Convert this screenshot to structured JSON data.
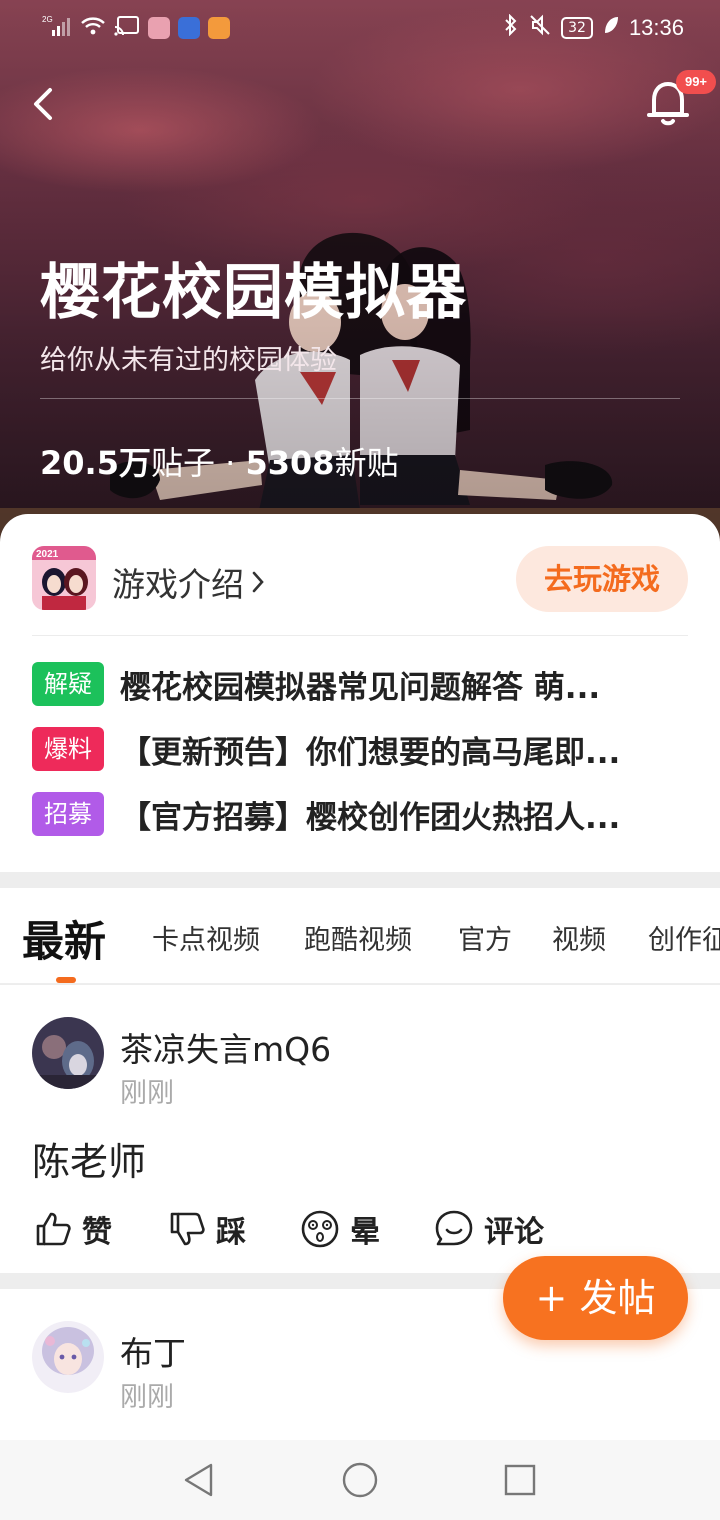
{
  "status_bar": {
    "network": "2G",
    "battery": "32",
    "time": "13:36"
  },
  "header": {
    "notification_badge": "99+"
  },
  "forum": {
    "title": "樱花校园模拟器",
    "subtitle": "给你从未有过的校园体验",
    "posts_count": "20.5万",
    "posts_label": "贴子",
    "separator": " · ",
    "new_count": "5308",
    "new_label": "新贴"
  },
  "game": {
    "intro_label": "游戏介绍",
    "play_button": "去玩游戏",
    "icon_year": "2021"
  },
  "notices": [
    {
      "tag": "解疑",
      "tag_color": "#1cc15b",
      "text": "樱花校园模拟器常见问题解答 萌..."
    },
    {
      "tag": "爆料",
      "tag_color": "#ee2a5a",
      "text": "【更新预告】你们想要的高马尾即..."
    },
    {
      "tag": "招募",
      "tag_color": "#b15be8",
      "text": "【官方招募】樱校创作团火热招人..."
    }
  ],
  "tabs": [
    "最新",
    "卡点视频",
    "跑酷视频",
    "官方",
    "视频",
    "创作征"
  ],
  "posts": [
    {
      "username": "茶凉失言mQ6",
      "time": "刚刚",
      "content": "陈老师",
      "actions": {
        "like": "赞",
        "dislike": "踩",
        "dizzy": "晕",
        "comment": "评论"
      }
    },
    {
      "username": "布丁",
      "time": "刚刚",
      "content": ""
    }
  ],
  "fab": {
    "label": "+ 发帖"
  },
  "colors": {
    "accent": "#f46b1e",
    "fab": "#f77220",
    "play_button_bg": "#fde8de"
  }
}
